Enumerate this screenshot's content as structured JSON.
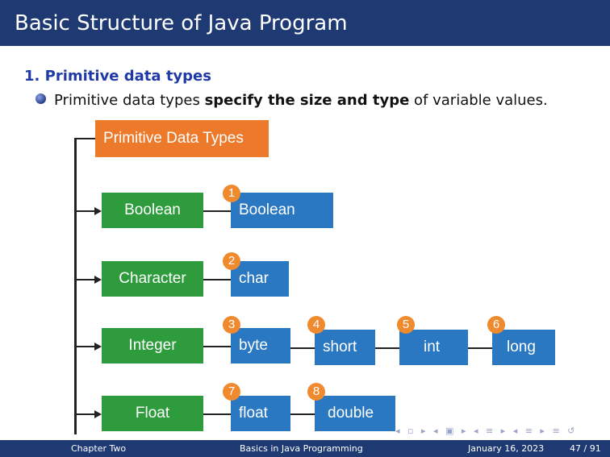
{
  "slide": {
    "title": "Basic Structure of Java Program",
    "section": "1. Primitive data types",
    "bullet_pre": "Primitive data types ",
    "bullet_bold": "specify the size and type",
    "bullet_post": " of variable values."
  },
  "diagram": {
    "root": "Primitive Data Types",
    "categories": [
      "Boolean",
      "Character",
      "Integer",
      "Float"
    ],
    "types": [
      {
        "num": "1",
        "label": "Boolean"
      },
      {
        "num": "2",
        "label": "char"
      },
      {
        "num": "3",
        "label": "byte"
      },
      {
        "num": "4",
        "label": "short"
      },
      {
        "num": "5",
        "label": "int"
      },
      {
        "num": "6",
        "label": "long"
      },
      {
        "num": "7",
        "label": "float"
      },
      {
        "num": "8",
        "label": "double"
      }
    ]
  },
  "footer": {
    "left": "Chapter Two",
    "center": "Basics in Java Programming",
    "date": "January 16, 2023",
    "page": "47 / 91"
  },
  "colors": {
    "header": "#1f3a73",
    "green": "#2e9c3c",
    "blue": "#2a78c2",
    "orange": "#ed7a2b",
    "accent": "#1f3aa6"
  }
}
